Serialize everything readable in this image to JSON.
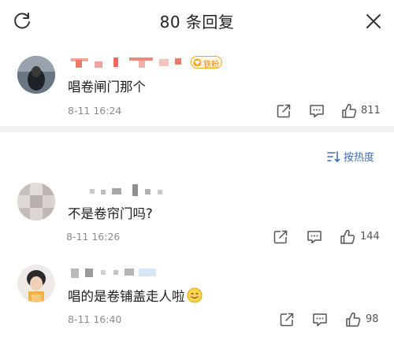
{
  "header": {
    "title": "80 条回复",
    "left_icon": "refresh-icon",
    "right_icon": "close-icon"
  },
  "comments": [
    {
      "badge": "铁粉",
      "text": "唱卷闸门那个",
      "time": "8-11 16:24",
      "likes": "811"
    },
    {
      "text": "不是卷帘门吗?",
      "time": "8-11 16:26",
      "likes": "144"
    },
    {
      "text": "唱的是卷铺盖走人啦",
      "time": "8-11 16:40",
      "likes": "98"
    }
  ],
  "sort": {
    "label": "按热度"
  },
  "colors": {
    "accent": "#3b6fb6",
    "badge": "#f5a623",
    "like": "#555555",
    "time": "#8c8c8c",
    "divider": "#f2f2f2"
  }
}
